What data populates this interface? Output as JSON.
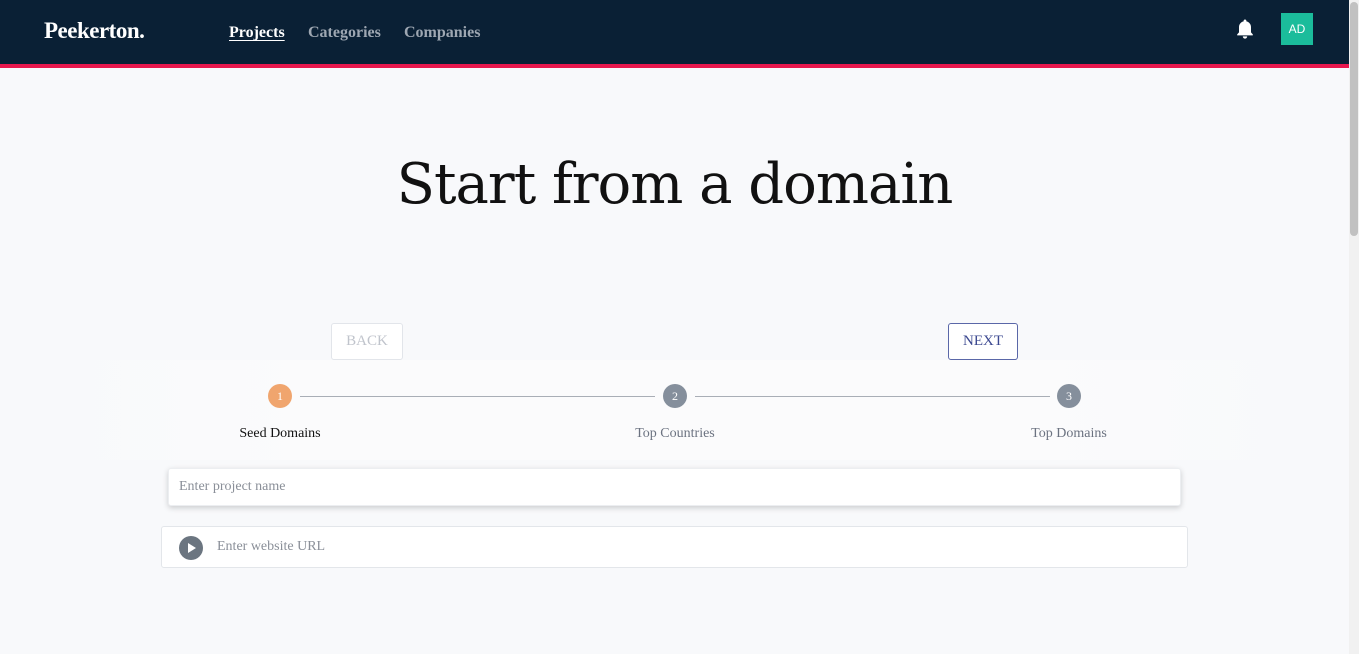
{
  "header": {
    "logo": "Peekerton.",
    "nav": [
      {
        "label": "Projects",
        "active": true
      },
      {
        "label": "Categories",
        "active": false
      },
      {
        "label": "Companies",
        "active": false
      }
    ],
    "notification_icon": "bell-icon",
    "avatar_initials": "AD"
  },
  "colors": {
    "navbar": "#0a2035",
    "accent_bar": "#e8174d",
    "avatar": "#1bbc9b",
    "active_step": "#f0a56e",
    "inactive_step": "#858f9c"
  },
  "main": {
    "title": "Start from a domain",
    "back_label": "BACK",
    "next_label": "NEXT",
    "steps": [
      {
        "number": "1",
        "label": "Seed Domains",
        "active": true
      },
      {
        "number": "2",
        "label": "Top Countries",
        "active": false
      },
      {
        "number": "3",
        "label": "Top Domains",
        "active": false
      }
    ],
    "project_name_placeholder": "Enter project name",
    "website_url_placeholder": "Enter website URL",
    "url_action_icon": "play-icon"
  }
}
